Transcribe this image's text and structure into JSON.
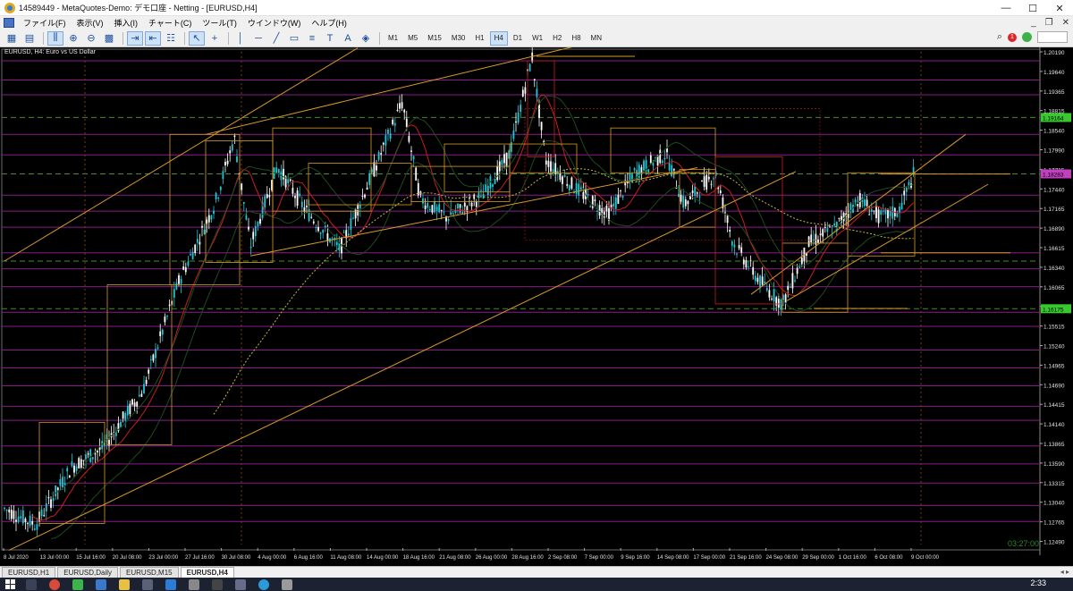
{
  "window": {
    "title": "14589449 - MetaQuotes-Demo: デモ口座 - Netting - [EURUSD,H4]",
    "minimize": "—",
    "maximize": "☐",
    "close": "✕"
  },
  "menu": {
    "items": [
      "ファイル(F)",
      "表示(V)",
      "挿入(I)",
      "チャート(C)",
      "ツール(T)",
      "ウインドウ(W)",
      "ヘルプ(H)"
    ],
    "mdi_min": "_",
    "mdi_restore": "❐",
    "mdi_close": "✕"
  },
  "toolbar": {
    "icons": [
      "new-chart-icon",
      "profiles-icon",
      "sep",
      "chart-mode-icon",
      "zoom-in-icon",
      "zoom-out-icon",
      "indicators-icon",
      "sep",
      "autoscroll-icon",
      "chart-shift-icon",
      "properties-icon",
      "sep",
      "cursor-icon",
      "crosshair-icon",
      "sep",
      "vertical-line-icon",
      "horizontal-line-icon",
      "trendline-icon",
      "rectangle-icon",
      "fibonacci-icon",
      "text-icon",
      "label-icon",
      "shapes-icon"
    ],
    "timeframes": [
      "M1",
      "M5",
      "M15",
      "M30",
      "H1",
      "H4",
      "D1",
      "W1",
      "H2",
      "H8",
      "MN"
    ],
    "active_timeframe": "H4",
    "notifications": "1"
  },
  "chart": {
    "label": "EURUSD, H4:  Euro vs US Dollar",
    "server_time": "03:27:00",
    "price_labels": [
      "1.20190",
      "1.19640",
      "1.19365",
      "1.18815",
      "1.18540",
      "1.17990",
      "1.17715",
      "1.17440",
      "1.17165",
      "1.16890",
      "1.16615",
      "1.16340",
      "1.16065",
      "1.15790",
      "1.15515",
      "1.15240",
      "1.14965",
      "1.14690",
      "1.14415",
      "1.14140",
      "1.13865",
      "1.13590",
      "1.13315",
      "1.13040",
      "1.12765",
      "1.12490"
    ],
    "highlighted_prices": [
      {
        "value": "1.19164",
        "color": "#38c92f"
      },
      {
        "value": "1.18283",
        "color": "#c040c0"
      },
      {
        "value": "1.16175",
        "color": "#38c92f"
      }
    ],
    "time_labels": [
      "8 Jul 2020",
      "13 Jul 00:00",
      "15 Jul 16:00",
      "20 Jul 08:00",
      "23 Jul 00:00",
      "27 Jul 16:00",
      "30 Jul 08:00",
      "4 Aug 00:00",
      "6 Aug 16:00",
      "11 Aug 08:00",
      "14 Aug 00:00",
      "18 Aug 16:00",
      "21 Aug 08:00",
      "26 Aug 00:00",
      "28 Aug 16:00",
      "2 Sep 08:00",
      "7 Sep 00:00",
      "9 Sep 16:00",
      "14 Sep 08:00",
      "17 Sep 00:00",
      "21 Sep 16:00",
      "24 Sep 08:00",
      "29 Sep 00:00",
      "1 Oct 16:00",
      "6 Oct 08:00",
      "9 Oct 00:00"
    ],
    "colors": {
      "bull": "#1ec8d8",
      "bear": "#ffffff",
      "grid": "#4a4a4a",
      "magenta_line": "#8a1a8a",
      "green_line": "#4a8a2a",
      "orange": "#d99a28",
      "red": "#c81e1e"
    }
  },
  "chart_data": {
    "type": "candlestick",
    "symbol": "EURUSD",
    "timeframe": "H4",
    "ylim": [
      1.1249,
      1.2019
    ],
    "x_range": [
      "8 Jul 2020",
      "9 Oct 2020"
    ]
  },
  "tabs": {
    "items": [
      "EURUSD,H1",
      "EURUSD,Daily",
      "EURUSD,M15",
      "EURUSD,H4"
    ],
    "active": 3,
    "scroll": "◂ ▸"
  },
  "taskbar": {
    "clock": "2:33"
  }
}
